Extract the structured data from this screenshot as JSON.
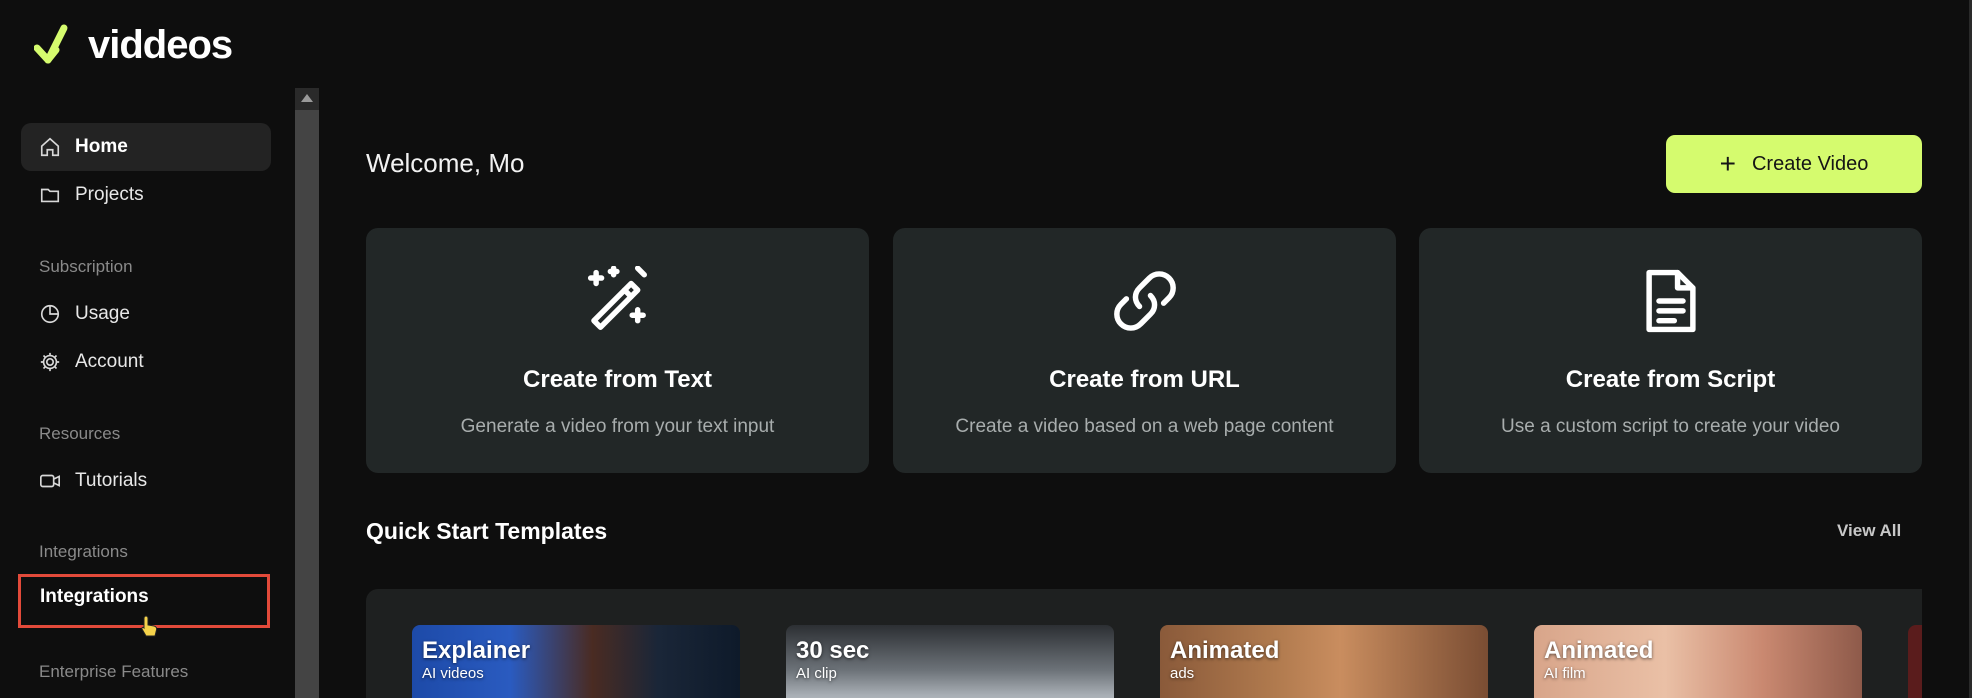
{
  "brand": {
    "name": "viddeos",
    "accent": "#d5fb6e"
  },
  "sidebar": {
    "items_top": [
      {
        "label": "Home",
        "icon": "home-icon",
        "active": true
      },
      {
        "label": "Projects",
        "icon": "folder-icon",
        "active": false
      }
    ],
    "sections": [
      {
        "label": "Subscription",
        "items": [
          {
            "label": "Usage",
            "icon": "pie-chart-icon"
          },
          {
            "label": "Account",
            "icon": "gear-icon"
          }
        ]
      },
      {
        "label": "Resources",
        "items": [
          {
            "label": "Tutorials",
            "icon": "video-camera-icon"
          }
        ]
      },
      {
        "label": "Integrations",
        "items": [
          {
            "label": "Integrations",
            "icon": ""
          }
        ]
      },
      {
        "label": "Enterprise Features",
        "items": []
      }
    ]
  },
  "main": {
    "welcome": "Welcome, Mo",
    "create_button": {
      "icon": "+",
      "label": "Create Video"
    },
    "cards": [
      {
        "title": "Create from Text",
        "description": "Generate a video from your text input",
        "icon": "magic-wand-icon"
      },
      {
        "title": "Create from URL",
        "description": "Create a video based on a web page content",
        "icon": "link-icon"
      },
      {
        "title": "Create from Script",
        "description": "Use a custom script to create your video",
        "icon": "document-icon"
      }
    ],
    "quick_start": {
      "title": "Quick Start Templates",
      "view_all": "View All",
      "templates": [
        {
          "title": "Explainer",
          "subtitle": "AI videos"
        },
        {
          "title": "30 sec",
          "subtitle": "AI clip"
        },
        {
          "title": "Animated",
          "subtitle": "ads"
        },
        {
          "title": "Animated",
          "subtitle": "AI film"
        }
      ]
    }
  }
}
